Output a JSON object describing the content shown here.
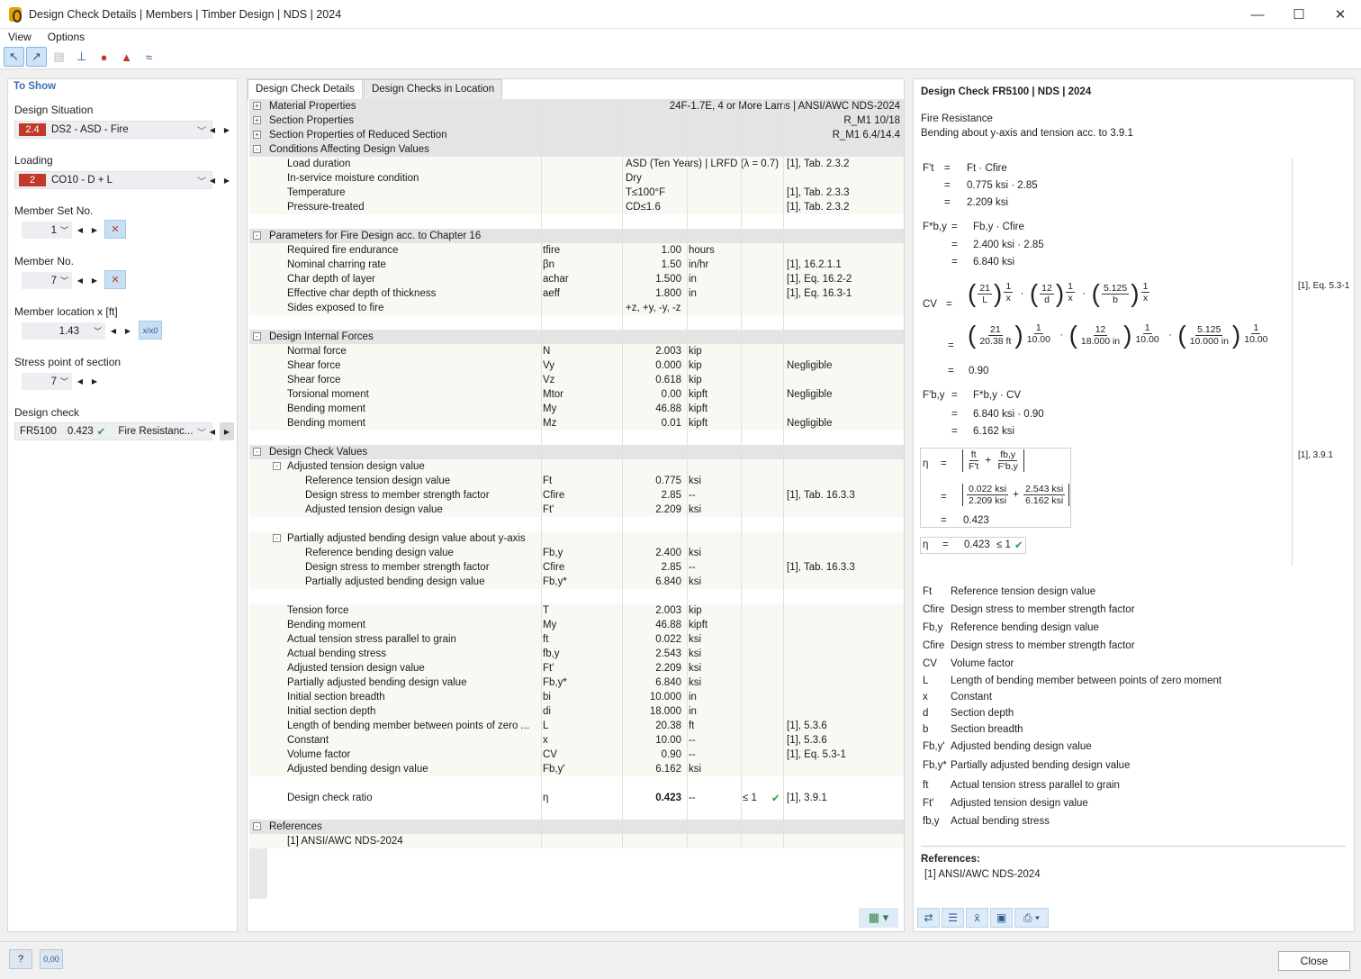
{
  "window": {
    "title": "Design Check Details | Members | Timber Design | NDS | 2024"
  },
  "menu": [
    "View",
    "Options"
  ],
  "left": {
    "header": "To Show",
    "design_situation_label": "Design Situation",
    "design_situation_badge": "2.4",
    "design_situation_value": "DS2 - ASD - Fire",
    "loading_label": "Loading",
    "loading_badge": "2",
    "loading_value": "CO10 - D + L",
    "member_set_label": "Member Set No.",
    "member_set_value": "1",
    "member_label": "Member No.",
    "member_value": "7",
    "location_label": "Member location x [ft]",
    "location_value": "1.43",
    "location_btn": "x/x0",
    "stress_point_label": "Stress point of section",
    "stress_point_value": "7",
    "design_check_label": "Design check",
    "design_check_id": "FR5100",
    "design_check_ratio": "0.423",
    "design_check_type": "Fire Resistanc..."
  },
  "tabs": [
    "Design Check Details",
    "Design Checks in Location"
  ],
  "rows": [
    {
      "k": "sec",
      "exp": "+",
      "name": "Material Properties",
      "right": "24F-1.7E, 4 or More Lams | ANSI/AWC NDS-2024"
    },
    {
      "k": "sec",
      "exp": "+",
      "name": "Section Properties",
      "right": "R_M1 10/18"
    },
    {
      "k": "sec",
      "exp": "+",
      "name": "Section Properties of Reduced Section",
      "right": "R_M1 6.4/14.4"
    },
    {
      "k": "sec",
      "exp": "-",
      "name": "Conditions Affecting Design Values"
    },
    {
      "k": "dat",
      "ind": 1,
      "name": "Load duration",
      "val": "ASD (Ten Years) | LRFD (λ = 0.7)",
      "valleft": true,
      "ref": "[1], Tab. 2.3.2"
    },
    {
      "k": "dat",
      "ind": 1,
      "name": "In-service moisture condition",
      "val": "Dry",
      "valleft": true
    },
    {
      "k": "dat",
      "ind": 1,
      "name": "Temperature",
      "val": "T≤100°F",
      "valleft": true,
      "ref": "[1], Tab. 2.3.3"
    },
    {
      "k": "dat",
      "ind": 1,
      "name": "Pressure-treated",
      "val": "CD≤1.6",
      "valleft": true,
      "ref": "[1], Tab. 2.3.2"
    },
    {
      "k": "blank"
    },
    {
      "k": "sec",
      "exp": "-",
      "name": "Parameters for Fire Design acc. to Chapter 16"
    },
    {
      "k": "dat",
      "ind": 1,
      "name": "Required fire endurance",
      "sym": "tfire",
      "val": "1.00",
      "unit": "hours"
    },
    {
      "k": "dat",
      "ind": 1,
      "name": "Nominal charring rate",
      "sym": "βn",
      "val": "1.50",
      "unit": "in/hr",
      "ref": "[1], 16.2.1.1"
    },
    {
      "k": "dat",
      "ind": 1,
      "name": "Char depth of layer",
      "sym": "achar",
      "val": "1.500",
      "unit": "in",
      "ref": "[1], Eq. 16.2-2"
    },
    {
      "k": "dat",
      "ind": 1,
      "name": "Effective char depth of thickness",
      "sym": "aeff",
      "val": "1.800",
      "unit": "in",
      "ref": "[1], Eq. 16.3-1"
    },
    {
      "k": "dat",
      "ind": 1,
      "name": "Sides exposed to fire",
      "val": "+z, +y, -y, -z",
      "valleft": true
    },
    {
      "k": "blank"
    },
    {
      "k": "sec",
      "exp": "-",
      "name": "Design Internal Forces"
    },
    {
      "k": "dat",
      "ind": 1,
      "name": "Normal force",
      "sym": "N",
      "val": "2.003",
      "unit": "kip"
    },
    {
      "k": "dat",
      "ind": 1,
      "name": "Shear force",
      "sym": "Vy",
      "val": "0.000",
      "unit": "kip",
      "ref": "Negligible"
    },
    {
      "k": "dat",
      "ind": 1,
      "name": "Shear force",
      "sym": "Vz",
      "val": "0.618",
      "unit": "kip"
    },
    {
      "k": "dat",
      "ind": 1,
      "name": "Torsional moment",
      "sym": "Mtor",
      "val": "0.00",
      "unit": "kipft",
      "ref": "Negligible"
    },
    {
      "k": "dat",
      "ind": 1,
      "name": "Bending moment",
      "sym": "My",
      "val": "46.88",
      "unit": "kipft"
    },
    {
      "k": "dat",
      "ind": 1,
      "name": "Bending moment",
      "sym": "Mz",
      "val": "0.01",
      "unit": "kipft",
      "ref": "Negligible"
    },
    {
      "k": "blank"
    },
    {
      "k": "sec",
      "exp": "-",
      "name": "Design Check Values"
    },
    {
      "k": "dat",
      "ind": 1,
      "exp": "-",
      "name": "Adjusted tension design value"
    },
    {
      "k": "dat",
      "ind": 2,
      "name": "Reference tension design value",
      "sym": "Ft",
      "val": "0.775",
      "unit": "ksi"
    },
    {
      "k": "dat",
      "ind": 2,
      "name": "Design stress to member strength factor",
      "sym": "Cfire",
      "val": "2.85",
      "unit": "--",
      "ref": "[1], Tab. 16.3.3"
    },
    {
      "k": "dat",
      "ind": 2,
      "name": "Adjusted tension design value",
      "sym": "Ft'",
      "val": "2.209",
      "unit": "ksi"
    },
    {
      "k": "blank"
    },
    {
      "k": "dat",
      "ind": 1,
      "exp": "-",
      "name": "Partially adjusted bending design value about y-axis"
    },
    {
      "k": "dat",
      "ind": 2,
      "name": "Reference bending design value",
      "sym": "Fb,y",
      "val": "2.400",
      "unit": "ksi"
    },
    {
      "k": "dat",
      "ind": 2,
      "name": "Design stress to member strength factor",
      "sym": "Cfire",
      "val": "2.85",
      "unit": "--",
      "ref": "[1], Tab. 16.3.3"
    },
    {
      "k": "dat",
      "ind": 2,
      "name": "Partially adjusted bending design value",
      "sym": "Fb,y*",
      "val": "6.840",
      "unit": "ksi"
    },
    {
      "k": "blank"
    },
    {
      "k": "dat",
      "ind": 1,
      "name": "Tension force",
      "sym": "T",
      "val": "2.003",
      "unit": "kip"
    },
    {
      "k": "dat",
      "ind": 1,
      "name": "Bending moment",
      "sym": "My",
      "val": "46.88",
      "unit": "kipft"
    },
    {
      "k": "dat",
      "ind": 1,
      "name": "Actual tension stress parallel to grain",
      "sym": "ft",
      "val": "0.022",
      "unit": "ksi"
    },
    {
      "k": "dat",
      "ind": 1,
      "name": "Actual bending stress",
      "sym": "fb,y",
      "val": "2.543",
      "unit": "ksi"
    },
    {
      "k": "dat",
      "ind": 1,
      "name": "Adjusted tension design value",
      "sym": "Ft'",
      "val": "2.209",
      "unit": "ksi"
    },
    {
      "k": "dat",
      "ind": 1,
      "name": "Partially adjusted bending design value",
      "sym": "Fb,y*",
      "val": "6.840",
      "unit": "ksi"
    },
    {
      "k": "dat",
      "ind": 1,
      "name": "Initial section breadth",
      "sym": "bi",
      "val": "10.000",
      "unit": "in"
    },
    {
      "k": "dat",
      "ind": 1,
      "name": "Initial section depth",
      "sym": "di",
      "val": "18.000",
      "unit": "in"
    },
    {
      "k": "dat",
      "ind": 1,
      "name": "Length of bending member between points of zero ...",
      "sym": "L",
      "val": "20.38",
      "unit": "ft",
      "ref": "[1], 5.3.6"
    },
    {
      "k": "dat",
      "ind": 1,
      "name": "Constant",
      "sym": "x",
      "val": "10.00",
      "unit": "--",
      "ref": "[1], 5.3.6"
    },
    {
      "k": "dat",
      "ind": 1,
      "name": "Volume factor",
      "sym": "CV",
      "val": "0.90",
      "unit": "--",
      "ref": "[1], Eq. 5.3-1"
    },
    {
      "k": "dat",
      "ind": 1,
      "name": "Adjusted bending design value",
      "sym": "Fb,y'",
      "val": "6.162",
      "unit": "ksi"
    },
    {
      "k": "blank"
    },
    {
      "k": "dat",
      "ind": 1,
      "name": "Design check ratio",
      "sym": "η",
      "val": "0.423",
      "unit": "--",
      "limit": "≤ 1",
      "ok": "✔",
      "ref": "[1], 3.9.1",
      "bold": true
    },
    {
      "k": "blank"
    },
    {
      "k": "sec",
      "exp": "-",
      "name": "References"
    },
    {
      "k": "dat",
      "ind": 1,
      "name": "[1]  ANSI/AWC NDS-2024"
    }
  ],
  "right": {
    "title": "Design Check FR5100 | NDS | 2024",
    "subtitle1": "Fire Resistance",
    "subtitle2": "Bending about y-axis and tension acc. to 3.9.1",
    "eq_ref1": "[1], Eq. 5.3-1",
    "eq_ref2": "[1], 3.9.1",
    "f1": {
      "lhs": "F't",
      "r1": "Ft · Cfire",
      "r2": "0.775 ksi · 2.85",
      "r3": "2.209 ksi"
    },
    "f2": {
      "lhs": "F*b,y",
      "r1": "Fb,y · Cfire",
      "r2": "2.400 ksi · 2.85",
      "r3": "6.840 ksi"
    },
    "cv": {
      "lhs": "CV",
      "n1": "21",
      "d1": "L",
      "n2": "12",
      "d2": "d",
      "n3": "5.125",
      "d3": "b",
      "e": "1",
      "ed": "x",
      "vn1": "21",
      "vd1": "20.38 ft",
      "vn2": "12",
      "vd2": "18.000 in",
      "vn3": "5.125",
      "vd3": "10.000 in",
      "ve": "1",
      "ved": "10.00",
      "res": "0.90"
    },
    "f3": {
      "lhs": "F'b,y",
      "r1": "F*b,y · CV",
      "r2": "6.840 ksi · 0.90",
      "r3": "6.162 ksi"
    },
    "eta": {
      "lhs": "η",
      "a_n": "ft",
      "a_d": "F't",
      "b_n": "fb,y",
      "b_d": "F'b,y",
      "c_n": "0.022 ksi",
      "c_d": "2.209 ksi",
      "d_n": "2.543 ksi",
      "d_d": "6.162 ksi",
      "res": "0.423",
      "final": "0.423",
      "limit": "≤ 1"
    },
    "legend": [
      {
        "s": "Ft",
        "t": "Reference tension design value"
      },
      {
        "s": "Cfire",
        "t": "Design stress to member strength factor"
      },
      {
        "s": "Fb,y",
        "t": "Reference bending design value"
      },
      {
        "s": "Cfire",
        "t": "Design stress to member strength factor"
      },
      {
        "s": "CV",
        "t": "Volume factor"
      },
      {
        "s": "L",
        "t": "Length of bending member between points of zero moment"
      },
      {
        "s": "x",
        "t": "Constant"
      },
      {
        "s": "d",
        "t": "Section depth"
      },
      {
        "s": "b",
        "t": "Section breadth"
      },
      {
        "s": "Fb,y'",
        "t": "Adjusted bending design value"
      },
      {
        "s": "Fb,y*",
        "t": "Partially adjusted bending design value"
      },
      {
        "s": "ft",
        "t": "Actual tension stress parallel to grain"
      },
      {
        "s": "Ft'",
        "t": "Adjusted tension design value"
      },
      {
        "s": "fb,y",
        "t": "Actual bending stress"
      }
    ],
    "refs_title": "References:",
    "refs": "[1]   ANSI/AWC NDS-2024"
  },
  "footer": {
    "close": "Close",
    "units_btn": "0,00"
  }
}
